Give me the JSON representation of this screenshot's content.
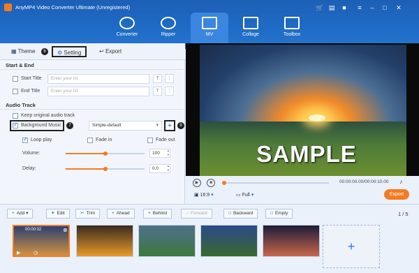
{
  "app": {
    "title": "AnyMP4 Video Converter Ultimate (Unregistered)"
  },
  "window_controls": [
    "cart-icon",
    "gift-icon",
    "chat-icon",
    "menu-icon",
    "minimize-icon",
    "close-icon"
  ],
  "nav": [
    {
      "label": "Converter",
      "icon": "convert-icon"
    },
    {
      "label": "Ripper",
      "icon": "disc-icon"
    },
    {
      "label": "MV",
      "icon": "image-icon",
      "active": true
    },
    {
      "label": "Collage",
      "icon": "collage-icon"
    },
    {
      "label": "Toolbox",
      "icon": "toolbox-icon"
    }
  ],
  "left_tabs": [
    {
      "label": "Theme",
      "badge": "6"
    },
    {
      "label": "Setting"
    },
    {
      "label": "Export"
    }
  ],
  "start_end": {
    "section": "Start & End",
    "start_label": "Start Title",
    "end_label": "End Title",
    "placeholder": "Enter your txt"
  },
  "audio": {
    "section": "Audio Track",
    "keep_label": "Keep original audio track",
    "bg_label": "Background Music",
    "bg_badge": "7",
    "track_value": "Simple-default",
    "add_badge": "8",
    "loop_label": "Loop play",
    "fade_in_label": "Fade in",
    "fade_out_label": "Fade out",
    "volume_label": "Volume:",
    "volume_value": "100",
    "volume_level": 0.5,
    "delay_label": "Delay:",
    "delay_value": "0.0",
    "delay_level": 0.5
  },
  "preview": {
    "watermark": "SAMPLE",
    "time": "00:00:00.00/00:00:10.00",
    "aspect": "16:9",
    "zoom": "Full",
    "export_label": "Export",
    "progress": 0.0
  },
  "toolbar": {
    "add": "Add",
    "edit": "Edit",
    "trim": "Trim",
    "ahead": "Ahead",
    "behind": "Behind",
    "forward": "Forward",
    "backward": "Backward",
    "empty": "Empty",
    "page": "1 / 5"
  },
  "clips": [
    {
      "time": "00:00:02",
      "selected": true,
      "colors": [
        "#2b3f73",
        "#e39a3b"
      ]
    },
    {
      "time": "",
      "selected": false,
      "colors": [
        "#3a2a20",
        "#f0a02a"
      ]
    },
    {
      "time": "",
      "selected": false,
      "colors": [
        "#4f6f8a",
        "#3c7a3a"
      ]
    },
    {
      "time": "",
      "selected": false,
      "colors": [
        "#2a4a8a",
        "#3a6a2a"
      ]
    },
    {
      "time": "",
      "selected": false,
      "colors": [
        "#1c1c3a",
        "#d06a4a"
      ]
    }
  ],
  "add_clip_icon": "plus-icon"
}
